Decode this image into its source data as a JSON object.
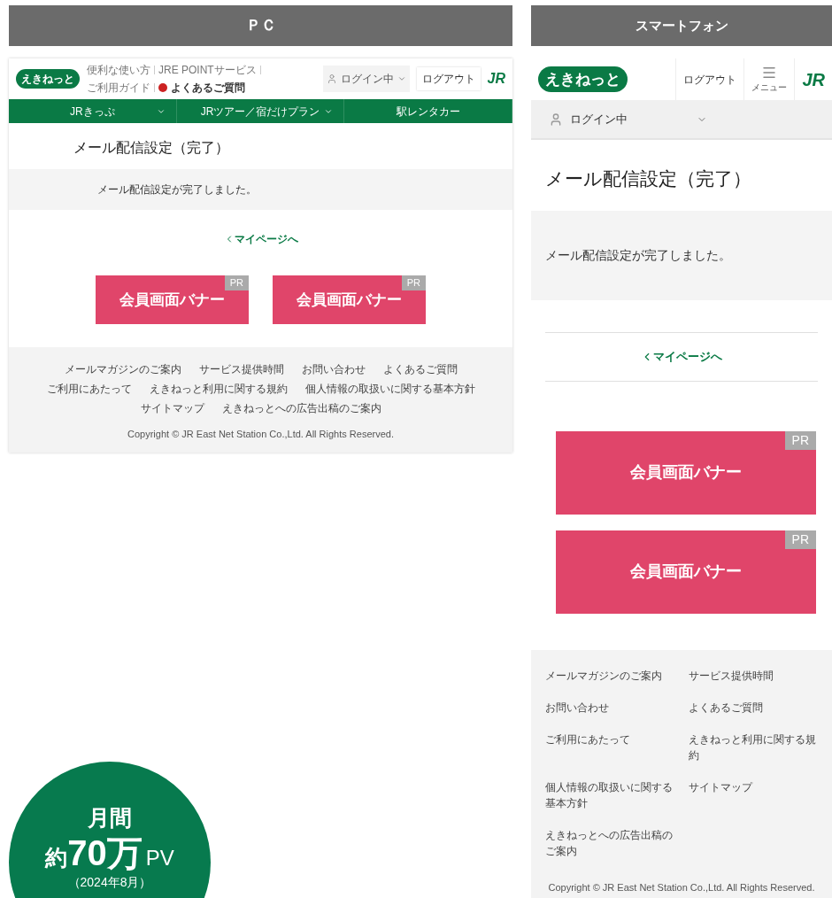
{
  "pc": {
    "heading": "ＰＣ",
    "logo": "えきねっと",
    "header_links": [
      {
        "label": "便利な使い方",
        "kind": "plain"
      },
      {
        "label": "JRE POINTサービス",
        "kind": "plain"
      },
      {
        "label": "ご利用ガイド",
        "kind": "plain"
      },
      {
        "label": "よくあるご質問",
        "kind": "faq"
      }
    ],
    "login_status": "ログイン中",
    "logout": "ログアウト",
    "jr_logo": "JR",
    "nav": [
      {
        "label": "JRきっぷ",
        "dropdown": true
      },
      {
        "label": "JRツアー／宿だけプラン",
        "dropdown": true
      },
      {
        "label": "駅レンタカー",
        "dropdown": false
      }
    ],
    "page_title": "メール配信設定（完了）",
    "message": "メール配信設定が完了しました。",
    "back_link": "マイページへ",
    "banners": [
      {
        "label": "会員画面バナー",
        "badge": "PR"
      },
      {
        "label": "会員画面バナー",
        "badge": "PR"
      }
    ],
    "footer_links": [
      "メールマガジンのご案内",
      "サービス提供時間",
      "お問い合わせ",
      "よくあるご質問",
      "ご利用にあたって",
      "えきねっと利用に関する規約",
      "個人情報の取扱いに関する基本方針",
      "サイトマップ",
      "えきねっとへの広告出稿のご案内"
    ],
    "copyright": "Copyright © JR East Net Station Co.,Ltd. All Rights Reserved."
  },
  "sp": {
    "heading": "スマートフォン",
    "logo": "えきねっと",
    "logout": "ログアウト",
    "menu_label": "メニュー",
    "jr_logo": "JR",
    "login_status": "ログイン中",
    "page_title": "メール配信設定（完了）",
    "message": "メール配信設定が完了しました。",
    "back_link": "マイページへ",
    "banners": [
      {
        "label": "会員画面バナー",
        "badge": "PR"
      },
      {
        "label": "会員画面バナー",
        "badge": "PR"
      }
    ],
    "footer_links": [
      "メールマガジンのご案内",
      "サービス提供時間",
      "お問い合わせ",
      "よくあるご質問",
      "ご利用にあたって",
      "えきねっと利用に関する規約",
      "個人情報の取扱いに関する基本方針",
      "サイトマップ",
      "えきねっとへの広告出稿のご案内"
    ],
    "copyright": "Copyright © JR East Net Station Co.,Ltd. All Rights Reserved."
  },
  "stat": {
    "label": "月間",
    "prefix": "約",
    "number": "70万",
    "unit": "PV",
    "period": "（2024年8月）"
  }
}
